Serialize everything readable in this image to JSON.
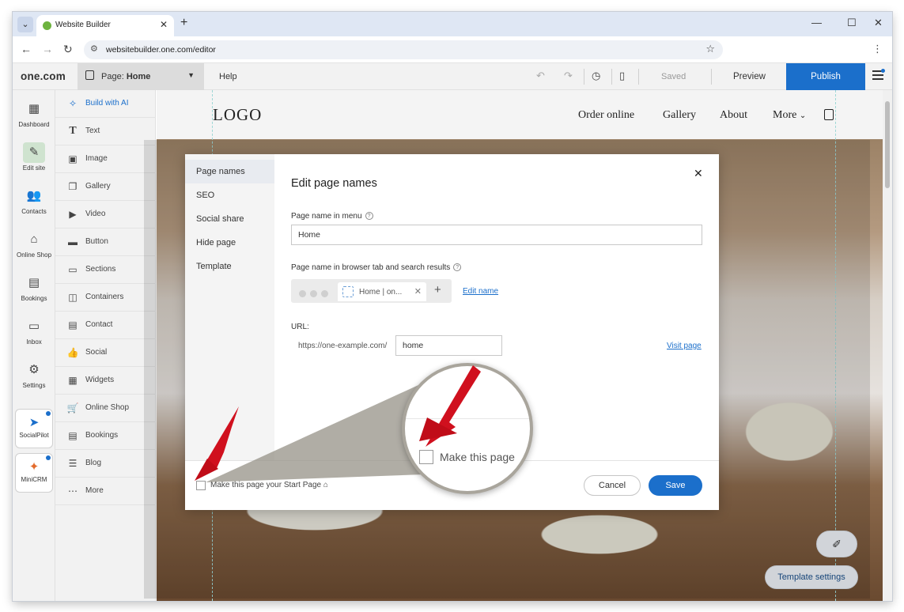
{
  "browser": {
    "tab_title": "Website Builder",
    "tab_favicon_color": "#6db33f",
    "url": "websitebuilder.one.com/editor"
  },
  "topbar": {
    "logo": "one.com",
    "page_selector_prefix": "Page:",
    "page_selector_value": "Home",
    "help_label": "Help",
    "saved_label": "Saved",
    "preview_label": "Preview",
    "publish_label": "Publish",
    "publish_color": "#1b6fcb"
  },
  "left_nav": [
    {
      "label": "Dashboard",
      "icon": "grid-icon"
    },
    {
      "label": "Edit site",
      "icon": "edit-site-icon"
    },
    {
      "label": "Contacts",
      "icon": "contacts-icon"
    },
    {
      "label": "Online Shop",
      "icon": "shop-icon"
    },
    {
      "label": "Bookings",
      "icon": "bookings-icon"
    },
    {
      "label": "Inbox",
      "icon": "inbox-icon"
    },
    {
      "label": "Settings",
      "icon": "gear-icon"
    }
  ],
  "left_apps": [
    {
      "label": "SocialPilot",
      "icon": "socialpilot-icon"
    },
    {
      "label": "MiniCRM",
      "icon": "minicrm-icon"
    }
  ],
  "elements": [
    {
      "label": "Build with AI",
      "icon": "sparkle-icon"
    },
    {
      "label": "Text",
      "icon": "text-icon"
    },
    {
      "label": "Image",
      "icon": "image-icon"
    },
    {
      "label": "Gallery",
      "icon": "gallery-icon"
    },
    {
      "label": "Video",
      "icon": "video-icon"
    },
    {
      "label": "Button",
      "icon": "button-icon"
    },
    {
      "label": "Sections",
      "icon": "sections-icon"
    },
    {
      "label": "Containers",
      "icon": "containers-icon"
    },
    {
      "label": "Contact",
      "icon": "contact-icon"
    },
    {
      "label": "Social",
      "icon": "social-icon"
    },
    {
      "label": "Widgets",
      "icon": "widgets-icon"
    },
    {
      "label": "Online Shop",
      "icon": "cart-icon"
    },
    {
      "label": "Bookings",
      "icon": "bookings-icon"
    },
    {
      "label": "Blog",
      "icon": "blog-icon"
    },
    {
      "label": "More",
      "icon": "more-icon"
    }
  ],
  "site": {
    "logo": "LOGO",
    "nav": [
      "Order online",
      "Gallery",
      "About",
      "More"
    ]
  },
  "canvas_buttons": {
    "template_settings": "Template settings"
  },
  "modal": {
    "tabs": [
      "Page names",
      "SEO",
      "Social share",
      "Hide page",
      "Template"
    ],
    "title": "Edit page names",
    "menu_name_label": "Page name in menu",
    "menu_name_value": "Home",
    "browser_name_label": "Page name in browser tab and search results",
    "browser_tab_preview": "Home | on...",
    "edit_name_link": "Edit name",
    "url_label": "URL:",
    "url_prefix": "https://one-example.com/",
    "url_value": "home",
    "visit_page_link": "Visit page",
    "start_page_label": "Make this page your Start Page",
    "cancel_label": "Cancel",
    "save_label": "Save"
  },
  "callout": {
    "magnified_label": "Make this page",
    "arrow_color": "#d0101e"
  }
}
